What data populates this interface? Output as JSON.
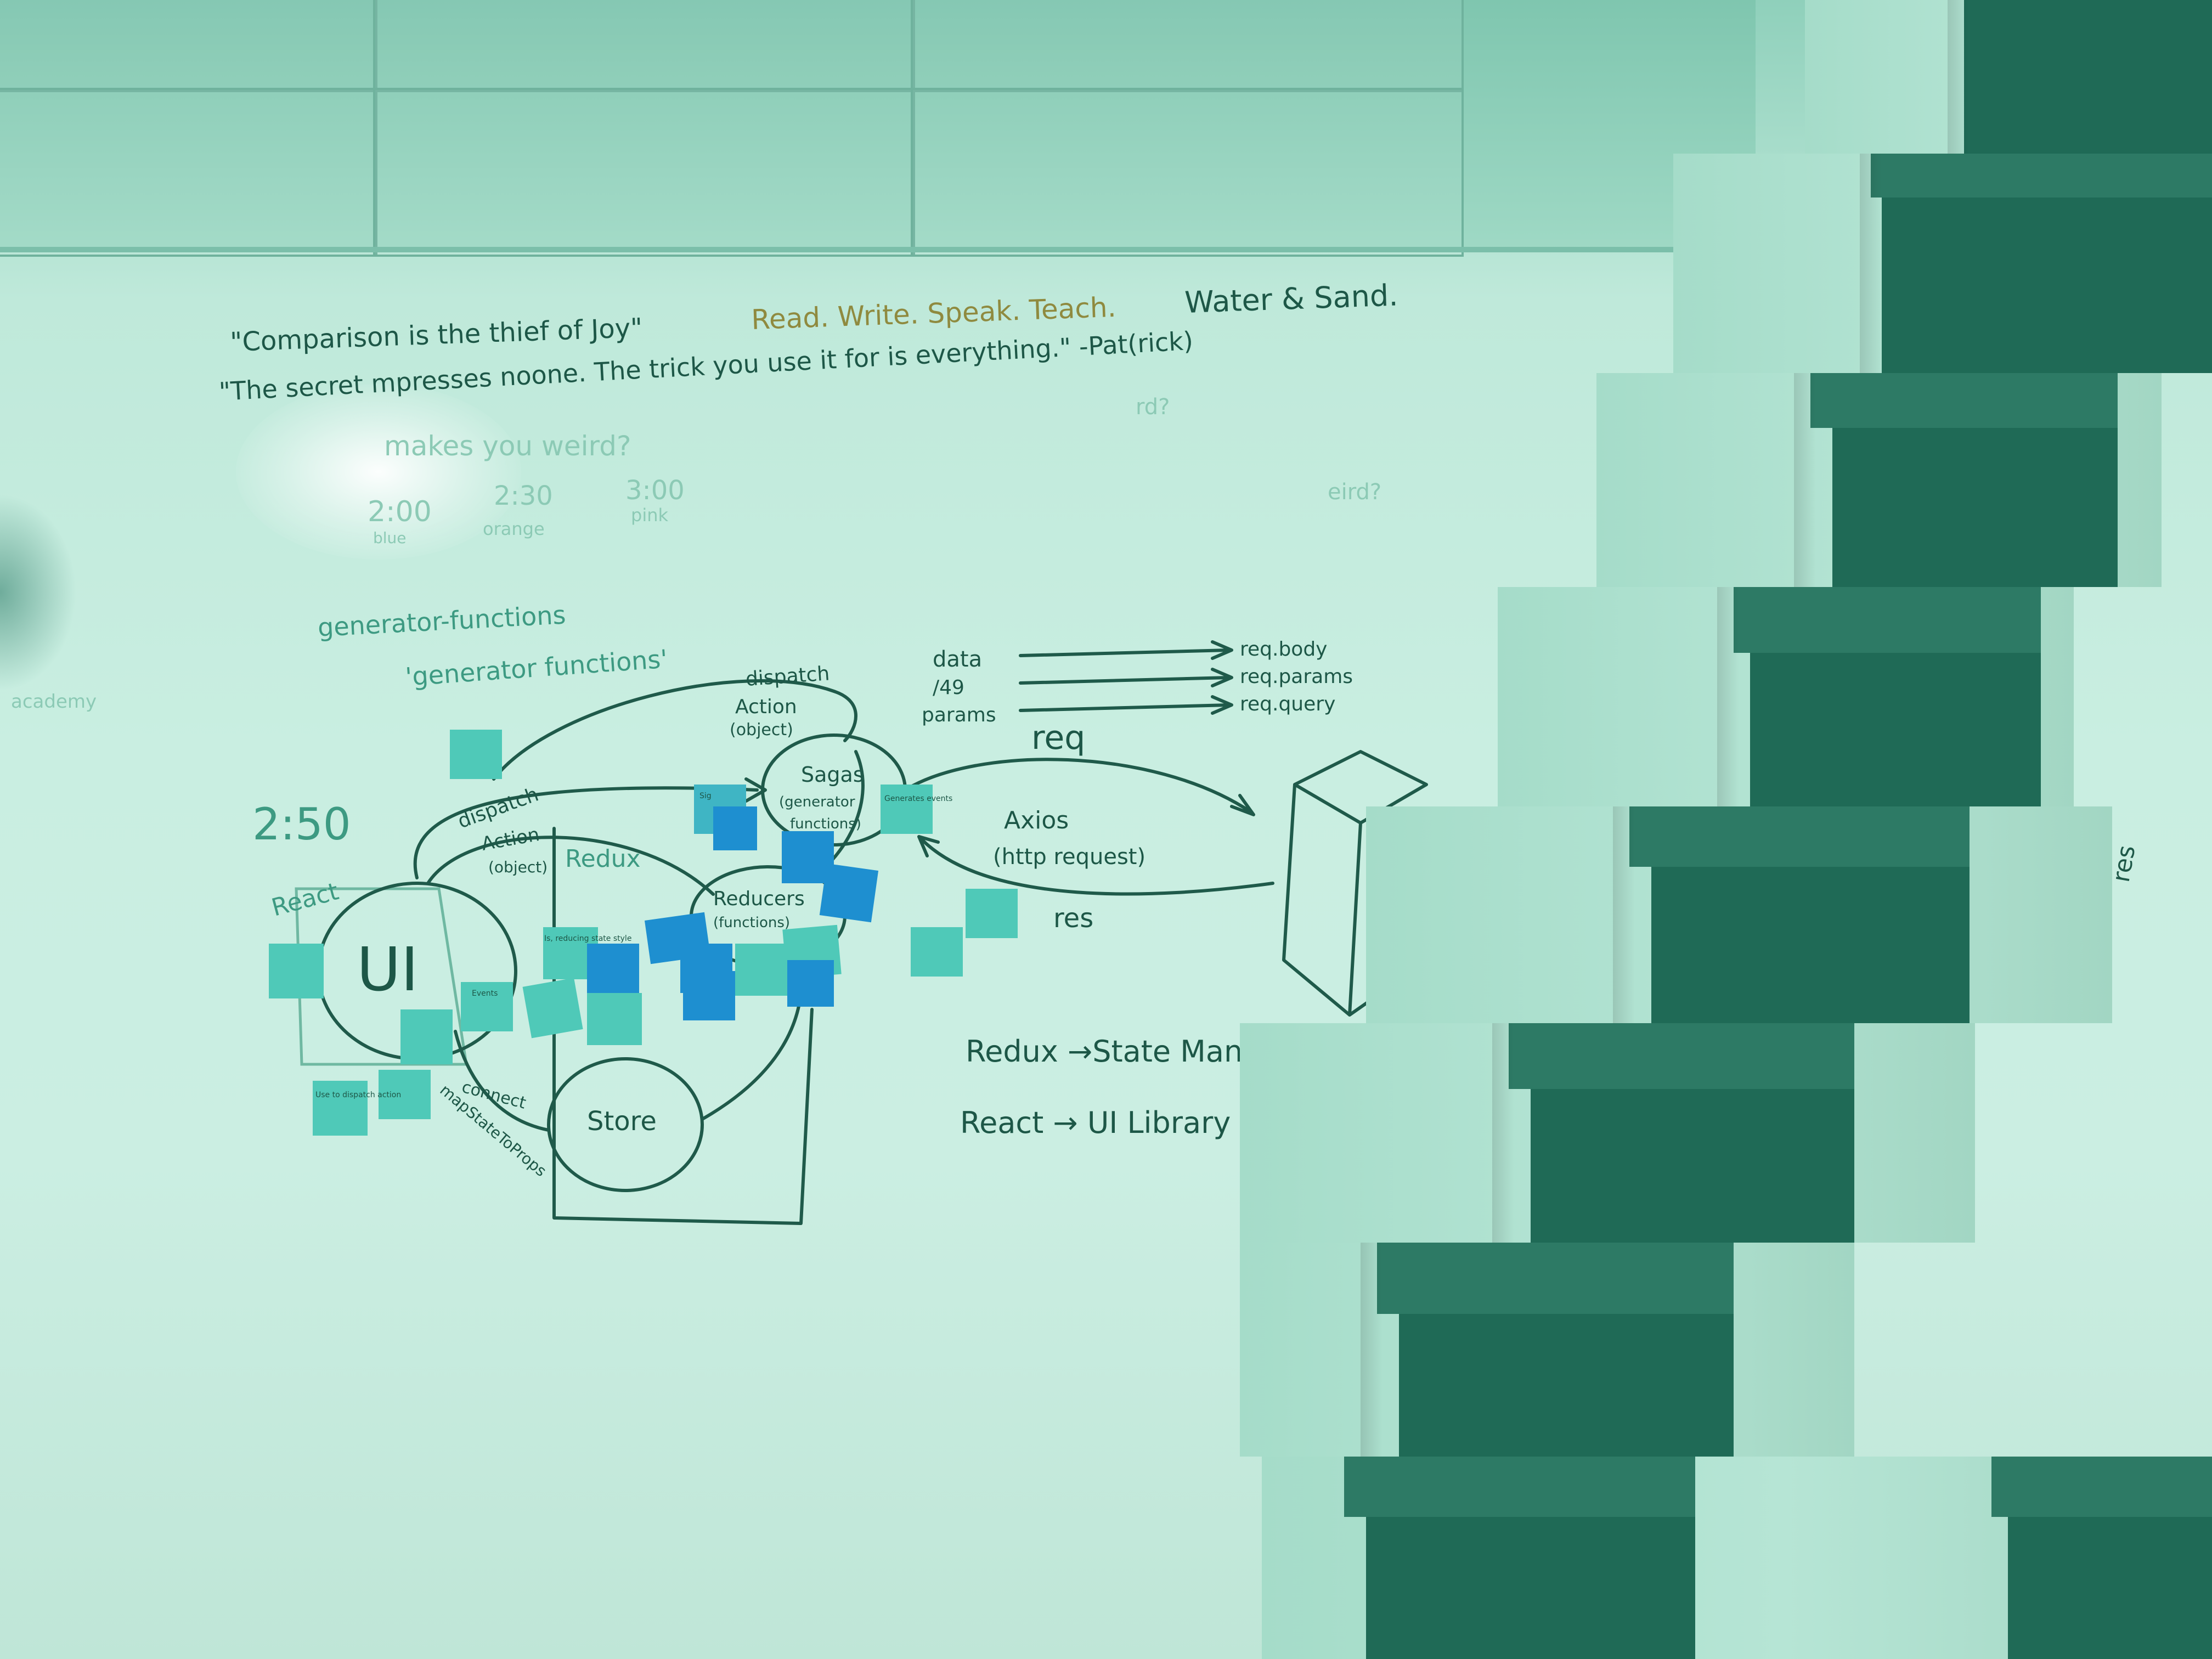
{
  "whiteboard": {
    "quote_line_1": "\"Comparison is the thief of Joy\"",
    "quote_words": "Read. Write. Speak. Teach.",
    "quote_water": "Water & Sand.",
    "quote_line_2": "\"The secret  mpresses noone. The trick you use it for is everything.\" -Pat(rick)",
    "faint_question": "makes you weird?",
    "faint_rd": "rd?",
    "faint_eird": "eird?",
    "time_1": "2:00",
    "time_1_label": "blue",
    "time_2": "2:30",
    "time_2_label": "orange",
    "time_3": "3:00",
    "time_3_label": "pink",
    "generator_1": "generator-functions",
    "generator_2": "'generator functions'",
    "left_word": "academy",
    "clock_250": "2:50",
    "dispatch_top": "dispatch",
    "action_top": "Action",
    "object_top": "(object)",
    "dispatch_left": "dispatch",
    "action_left": "Action",
    "object_left": "(object)",
    "react_label": "React",
    "redux_label": "Redux",
    "ui_label": "UI",
    "sagas_label": "Sagas",
    "sagas_sub_1": "(generator",
    "sagas_sub_2": "functions)",
    "reducers_label": "Reducers",
    "reducers_sub": "(functions)",
    "store_label": "Store",
    "connect_label": "connect",
    "map_label": "mapStateToProps",
    "data_label": "data",
    "slash49_label": "/49",
    "params_label": "params",
    "req_body": "req.body",
    "req_params": "req.params",
    "req_query": "req.query",
    "req_label": "req",
    "axios_label": "Axios",
    "http_label": "(http request)",
    "res_label": "res",
    "redux_state": "Redux →State Man",
    "react_ui": "React → UI Library",
    "right_res": "res",
    "sticky_note_1": "Use to dispatch action",
    "sticky_note_2": "Is, reducing state style",
    "sticky_note_3": "Events",
    "sticky_note_4": "Sig",
    "sticky_note_5": "Generates events"
  },
  "colors": {
    "tint": "#9fd8c4",
    "ink": "#1d5747",
    "sticky_teal": "#4fc9b8",
    "sticky_blue": "#1e8fd0",
    "block_dark": "#1f6a56"
  }
}
